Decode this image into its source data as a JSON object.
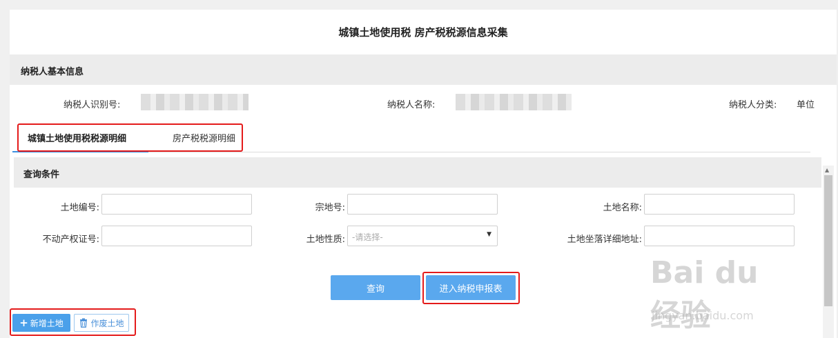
{
  "page": {
    "title": "城镇土地使用税 房产税税源信息采集"
  },
  "basic_info": {
    "section_title": "纳税人基本信息",
    "taxpayer_id_label": "纳税人识别号:",
    "taxpayer_name_label": "纳税人名称:",
    "taxpayer_type_label": "纳税人分类:",
    "taxpayer_type_value": "单位"
  },
  "tabs": [
    {
      "label": "城镇土地使用税税源明细",
      "active": true
    },
    {
      "label": "房产税税源明细",
      "active": false
    }
  ],
  "query": {
    "section_title": "查询条件",
    "fields": {
      "land_no": {
        "label": "土地编号:",
        "value": ""
      },
      "parcel_no": {
        "label": "宗地号:",
        "value": ""
      },
      "land_name": {
        "label": "土地名称:",
        "value": ""
      },
      "property_cert_no": {
        "label": "不动产权证号:",
        "value": ""
      },
      "land_nature": {
        "label": "土地性质:",
        "placeholder": "-请选择-"
      },
      "land_address": {
        "label": "土地坐落详细地址:",
        "value": ""
      }
    },
    "query_button": "查询",
    "enter_declaration_button": "进入纳税申报表"
  },
  "actions": {
    "add_land": "新增土地",
    "void_land": "作废土地"
  },
  "watermark": {
    "main": "Bai du 经验",
    "sub": "jingyan.baidu.com"
  },
  "colors": {
    "accent": "#5aa8ee",
    "highlight_box": "#e41a1a",
    "tab_underline": "#3b8fe0"
  }
}
